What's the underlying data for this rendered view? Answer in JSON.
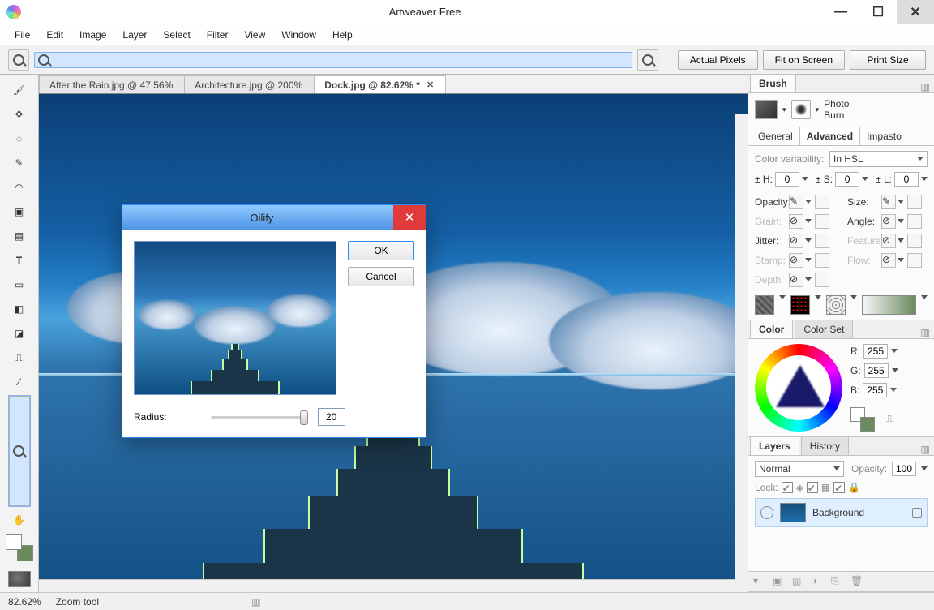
{
  "app_title": "Artweaver Free",
  "menu": [
    "File",
    "Edit",
    "Image",
    "Layer",
    "Select",
    "Filter",
    "View",
    "Window",
    "Help"
  ],
  "optbar": {
    "actual": "Actual Pixels",
    "fit": "Fit on Screen",
    "print": "Print Size"
  },
  "doc_tabs": [
    {
      "label": "After the Rain.jpg @ 47.56%",
      "active": false
    },
    {
      "label": "Architecture.jpg @ 200%",
      "active": false
    },
    {
      "label": "Dock.jpg @ 82.62% *",
      "active": true
    }
  ],
  "dialog": {
    "title": "Oilify",
    "ok": "OK",
    "cancel": "Cancel",
    "radius_label": "Radius:",
    "radius_value": "20"
  },
  "brush_panel": {
    "tab": "Brush",
    "variant_name": "Photo",
    "variant_sub": "Burn",
    "subtabs": [
      "General",
      "Advanced",
      "Impasto"
    ],
    "cv_label": "Color variability:",
    "cv_value": "In HSL",
    "hsl": {
      "h_label": "± H:",
      "h": "0",
      "s_label": "± S:",
      "s": "0",
      "l_label": "± L:",
      "l": "0"
    },
    "params": {
      "opacity": "Opacity:",
      "size": "Size:",
      "grain": "Grain:",
      "angle": "Angle:",
      "jitter": "Jitter:",
      "feature": "Feature:",
      "stamp": "Stamp:",
      "flow": "Flow:",
      "depth": "Depth:"
    }
  },
  "color_panel": {
    "tabs": [
      "Color",
      "Color Set"
    ],
    "r": "R:",
    "g": "G:",
    "b": "B:",
    "rv": "255",
    "gv": "255",
    "bv": "255"
  },
  "layers_panel": {
    "tabs": [
      "Layers",
      "History"
    ],
    "mode": "Normal",
    "opacity_label": "Opacity:",
    "opacity": "100",
    "lock_label": "Lock:",
    "layer_name": "Background"
  },
  "status": {
    "zoom": "82.62%",
    "tool": "Zoom tool"
  }
}
